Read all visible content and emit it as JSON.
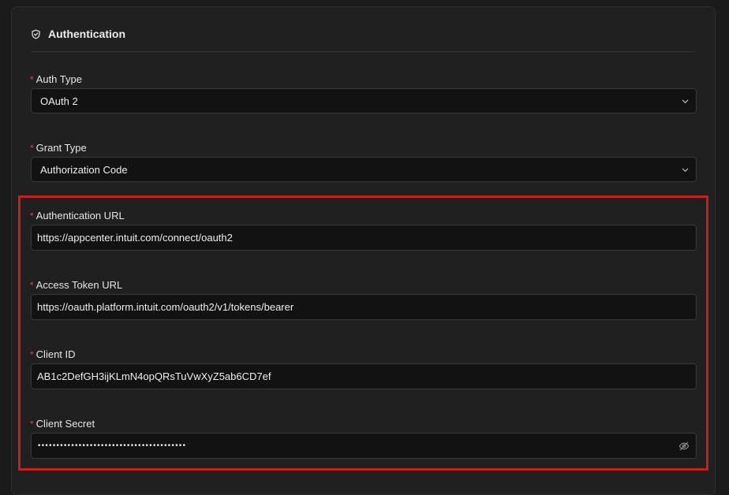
{
  "section": {
    "title": "Authentication",
    "icon": "shield-check-icon"
  },
  "required_marker": "*",
  "fields": {
    "auth_type": {
      "label": "Auth Type",
      "value": "OAuth 2"
    },
    "grant_type": {
      "label": "Grant Type",
      "value": "Authorization Code"
    },
    "authentication_url": {
      "label": "Authentication URL",
      "value": "https://appcenter.intuit.com/connect/oauth2"
    },
    "access_token_url": {
      "label": "Access Token URL",
      "value": "https://oauth.platform.intuit.com/oauth2/v1/tokens/bearer"
    },
    "client_id": {
      "label": "Client ID",
      "value": "AB1c2DefGH3ijKLmN4opQRsTuVwXyZ5ab6CD7ef"
    },
    "client_secret": {
      "label": "Client Secret",
      "value": "••••••••••••••••••••••••••••••••••••••••",
      "toggle_icon": "eye-off-icon"
    }
  },
  "colors": {
    "background": "#1b1b1b",
    "panel": "#202020",
    "input_background": "#121212",
    "required": "#e0483d",
    "highlight": "#c8201f"
  }
}
